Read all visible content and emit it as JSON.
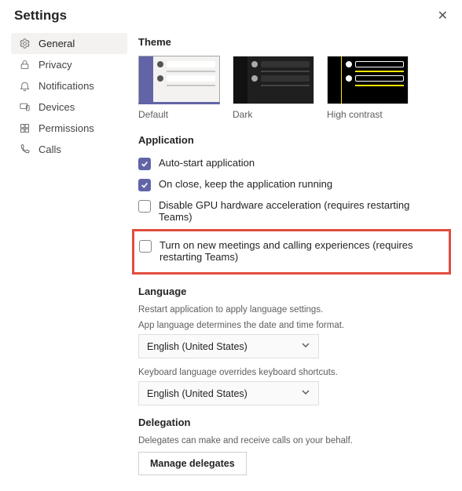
{
  "header": {
    "title": "Settings"
  },
  "sidebar": {
    "items": [
      {
        "label": "General"
      },
      {
        "label": "Privacy"
      },
      {
        "label": "Notifications"
      },
      {
        "label": "Devices"
      },
      {
        "label": "Permissions"
      },
      {
        "label": "Calls"
      }
    ]
  },
  "theme": {
    "title": "Theme",
    "options": [
      {
        "label": "Default"
      },
      {
        "label": "Dark"
      },
      {
        "label": "High contrast"
      }
    ]
  },
  "application": {
    "title": "Application",
    "items": [
      {
        "label": "Auto-start application",
        "checked": true
      },
      {
        "label": "On close, keep the application running",
        "checked": true
      },
      {
        "label": "Disable GPU hardware acceleration (requires restarting Teams)",
        "checked": false
      },
      {
        "label": "Turn on new meetings and calling experiences (requires restarting Teams)",
        "checked": false
      }
    ]
  },
  "language": {
    "title": "Language",
    "restart_note": "Restart application to apply language settings.",
    "app_lang_note": "App language determines the date and time format.",
    "app_lang_value": "English (United States)",
    "kb_lang_note": "Keyboard language overrides keyboard shortcuts.",
    "kb_lang_value": "English (United States)"
  },
  "delegation": {
    "title": "Delegation",
    "note": "Delegates can make and receive calls on your behalf.",
    "button": "Manage delegates"
  }
}
